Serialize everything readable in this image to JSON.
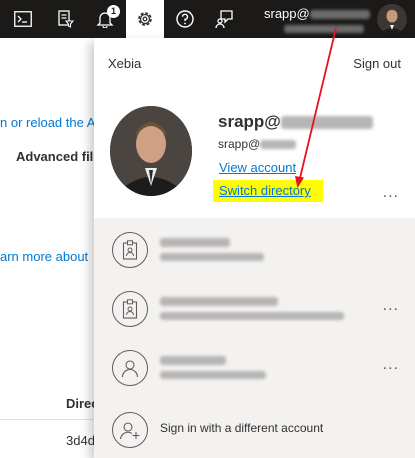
{
  "topbar": {
    "notification_count": "1",
    "user_name_visible": "srapp@",
    "icons": [
      "cloud-shell-icon",
      "directory-filter-icon",
      "notifications-icon",
      "settings-icon",
      "help-icon",
      "feedback-icon"
    ]
  },
  "background_page": {
    "reload_text": "n or reload the A:",
    "filters_label": "Advanced fil",
    "learn_more": "arn more about",
    "column_header": "Direc",
    "cell_value": "3d4d"
  },
  "account_panel": {
    "tenant_name": "Xebia",
    "sign_out_label": "Sign out",
    "user_name_prefix": "srapp@",
    "user_email_prefix": "srapp@",
    "view_account_label": "View account",
    "switch_directory_label": "Switch directory",
    "more_label": "...",
    "other_accounts": [
      {
        "icon": "badge-icon",
        "more": ""
      },
      {
        "icon": "badge-icon",
        "more": "..."
      },
      {
        "icon": "person-icon",
        "more": "..."
      }
    ],
    "sign_in_different_label": "Sign in with a different account"
  },
  "colors": {
    "topbar": "#1b1a19",
    "link": "#0078d4",
    "highlight": "#fdfd00",
    "annotation_arrow": "#e81123",
    "section_background": "#f3f2f1"
  }
}
